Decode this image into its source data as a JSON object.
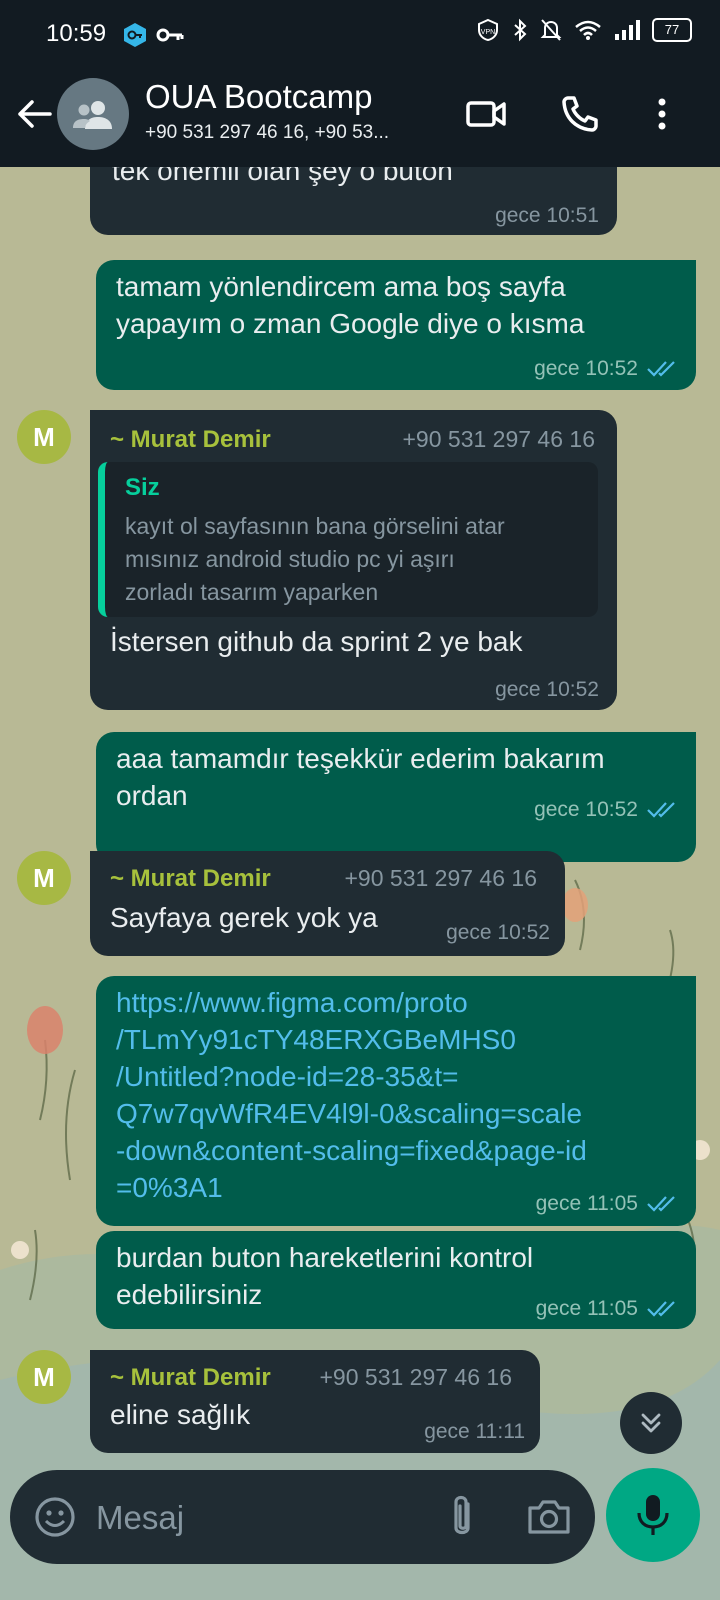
{
  "status_bar": {
    "time": "10:59",
    "battery": "77",
    "icons": [
      "vpn-key-app-icon",
      "key-icon",
      "vpn-icon",
      "bluetooth-icon",
      "muted-bell-icon",
      "wifi-icon",
      "signal-icon",
      "battery-icon"
    ]
  },
  "header": {
    "title": "OUA Bootcamp",
    "subtitle": "+90 531 297 46 16, +90 53..."
  },
  "messages": [
    {
      "type": "in",
      "text_lines": [
        "tek önemli olan şey o buton"
      ],
      "time": "gece 10:51"
    },
    {
      "type": "out",
      "text_lines": [
        "tamam yönlendircem ama boş sayfa",
        "yapayım o zman Google diye o kısma"
      ],
      "time": "gece 10:52",
      "status": "read"
    },
    {
      "type": "in",
      "avatar": "M",
      "sender": "~ Murat Demir",
      "phone": "+90 531 297 46 16",
      "quote": {
        "name": "Siz",
        "lines": [
          "kayıt ol sayfasının bana görselini atar",
          "mısınız android studio pc yi aşırı",
          "zorladı tasarım yaparken"
        ]
      },
      "text_lines": [
        "İstersen github da sprint 2 ye bak"
      ],
      "time": "gece 10:52"
    },
    {
      "type": "out",
      "text_lines": [
        "aaa tamamdır teşekkür ederim bakarım",
        "ordan"
      ],
      "time": "gece 10:52",
      "status": "read"
    },
    {
      "type": "in",
      "avatar": "M",
      "sender": "~ Murat Demir",
      "phone": "+90 531 297 46 16",
      "text_lines": [
        "Sayfaya gerek yok ya"
      ],
      "time": "gece 10:52"
    },
    {
      "type": "out",
      "link_lines": [
        "https://www.figma.com/proto",
        "/TLmYy91cTY48ERXGBeMHS0",
        "/Untitled?node-id=28-35&t=",
        "Q7w7qvWfR4EV4l9l-0&scaling=scale",
        "-down&content-scaling=fixed&page-id",
        "=0%3A1"
      ],
      "time": "gece 11:05",
      "status": "read"
    },
    {
      "type": "out",
      "text_lines": [
        "burdan buton hareketlerini kontrol",
        "edebilirsiniz"
      ],
      "time": "gece 11:05",
      "status": "read"
    },
    {
      "type": "in",
      "avatar": "M",
      "sender": "~ Murat Demir",
      "phone": "+90 531 297 46 16",
      "text_lines": [
        "eline sağlık"
      ],
      "time": "gece 11:11"
    }
  ],
  "composer": {
    "placeholder": "Mesaj"
  },
  "colors": {
    "header_bg": "#121b22",
    "incoming_bubble": "#202c33",
    "outgoing_bubble": "#005c4b",
    "sender_name": "#a7c13c",
    "quote_accent": "#06cf9c",
    "link": "#53bdeb",
    "read_ticks": "#53bdeb",
    "mic_button": "#00a884"
  }
}
